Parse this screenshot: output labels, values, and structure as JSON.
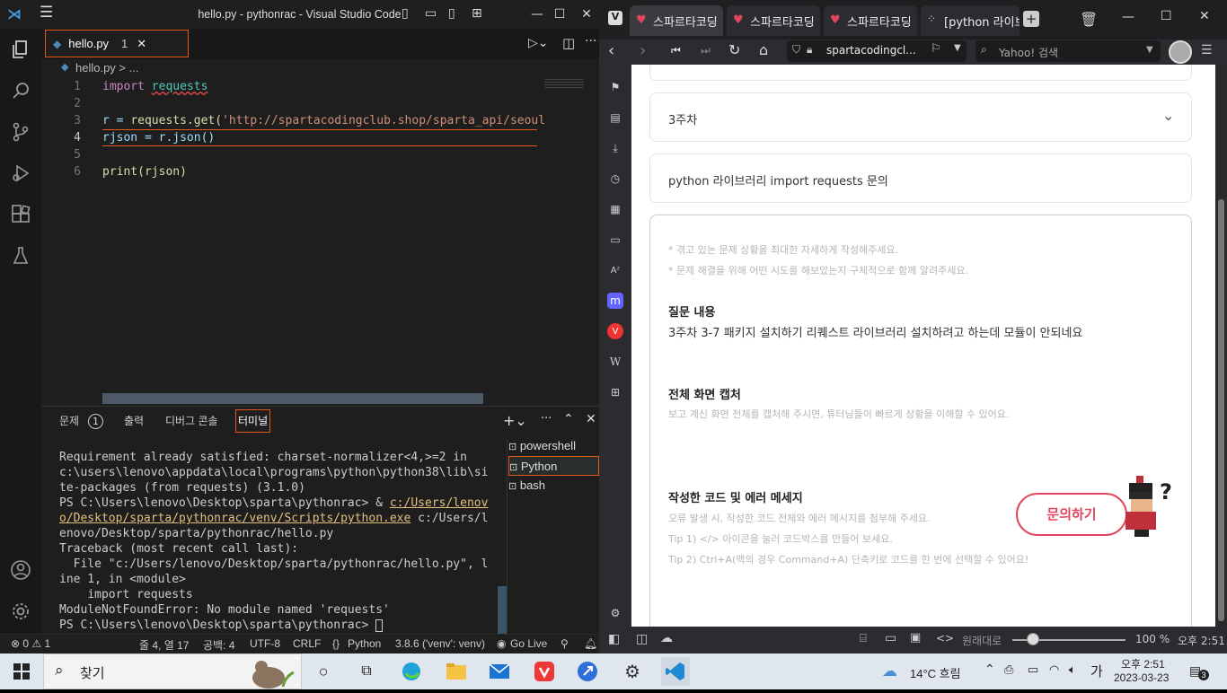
{
  "vscode": {
    "title": "hello.py - pythonrac - Visual Studio Code",
    "tab": {
      "name": "hello.py",
      "problems": "1"
    },
    "breadcrumb": "hello.py > ...",
    "lines": [
      {
        "n": "1",
        "a": "import ",
        "b": "requests"
      },
      {
        "n": "2"
      },
      {
        "n": "3",
        "a": "r = ",
        "b": "requests.get(",
        "c": "'http://spartacodingclub.shop/sparta_api/seoul"
      },
      {
        "n": "4",
        "a": "rjson = r.json()"
      },
      {
        "n": "5"
      },
      {
        "n": "6",
        "a": "print(rjson)"
      }
    ],
    "panel_tabs": {
      "problems": "문제",
      "problems_count": "1",
      "output": "출력",
      "debug": "디버그 콘솔",
      "terminal": "터미널"
    },
    "terminal": {
      "l1": "Requirement already satisfied: charset-normalizer<4,>=2 in c:\\users\\lenovo\\appdata\\local\\programs\\python\\python38\\lib\\site-packages (from requests) (3.1.0)",
      "l2a": "PS C:\\Users\\lenovo\\Desktop\\sparta\\pythonrac> & ",
      "l2b": "c:/Users/lenovo/Desktop/sparta/pythonrac/venv/Scripts/python.exe",
      "l2c": " c:/Users/lenovo/Desktop/sparta/pythonrac/hello.py",
      "l3": "Traceback (most recent call last):",
      "l4": "  File \"c:/Users/lenovo/Desktop/sparta/pythonrac/hello.py\", line 1, in <module>",
      "l5": "    import requests",
      "l6": "ModuleNotFoundError: No module named 'requests'",
      "l7": "PS C:\\Users\\lenovo\\Desktop\\sparta\\pythonrac> "
    },
    "terminal_list": [
      "powershell",
      "Python",
      "bash"
    ],
    "status": {
      "errors": "⊗ 0 ⚠ 1",
      "pos": "줄 4, 열 17",
      "spaces": "공백: 4",
      "enc": "UTF-8",
      "eol": "CRLF",
      "lang": "Python",
      "interp": "3.8.6 ('venv': venv)",
      "golive": "Go Live"
    }
  },
  "browser": {
    "tabs": [
      "스파르타코딩",
      "스파르타코딩",
      "스파르타코딩",
      "[python 라이브"
    ],
    "url": "spartacodingcl...",
    "search_placeholder": "Yahoo! 검색",
    "week": "3주차",
    "title_input": "python 라이브러리 import requests 문의",
    "hints": [
      "* 겪고 있는 문제 상황을 최대한 자세하게 작성해주세요.",
      "* 문제 해결을 위해 어떤 시도를 해보았는지 구체적으로 함께 알려주세요."
    ],
    "q_head": "질문 내용",
    "q_body": "3주차 3-7 패키지 설치하기 리퀘스트 라이브러리 설치하려고 하는데 모듈이 안되네요",
    "cap_head": "전체 화면 캡처",
    "cap_body": "보고 계신 화면 전체를 캡처해 주시면, 튜터님들이 빠르게 상황을 이해할 수 있어요.",
    "code_head": "작성한 코드 및 에러 메세지",
    "code_hints": [
      "오류 발생 시, 작성한 코드 전체와 에러 메시지를 첨부해 주세요.",
      "Tip 1) </> 아이콘을 눌러 코드박스를 만들어 보세요.",
      "Tip 2) Ctrl+A(맥의 경우 Command+A) 단축키로 코드를 한 번에 선택할 수 있어요!"
    ],
    "ask_button": "문의하기",
    "status_zoom_label": "원래대로",
    "zoom": "100 %",
    "time": "오후 2:51"
  },
  "taskbar": {
    "search": "찾기",
    "weather": "14°C 흐림",
    "ime": "가",
    "time": "오후 2:51",
    "date": "2023-03-23",
    "notif": "3"
  }
}
